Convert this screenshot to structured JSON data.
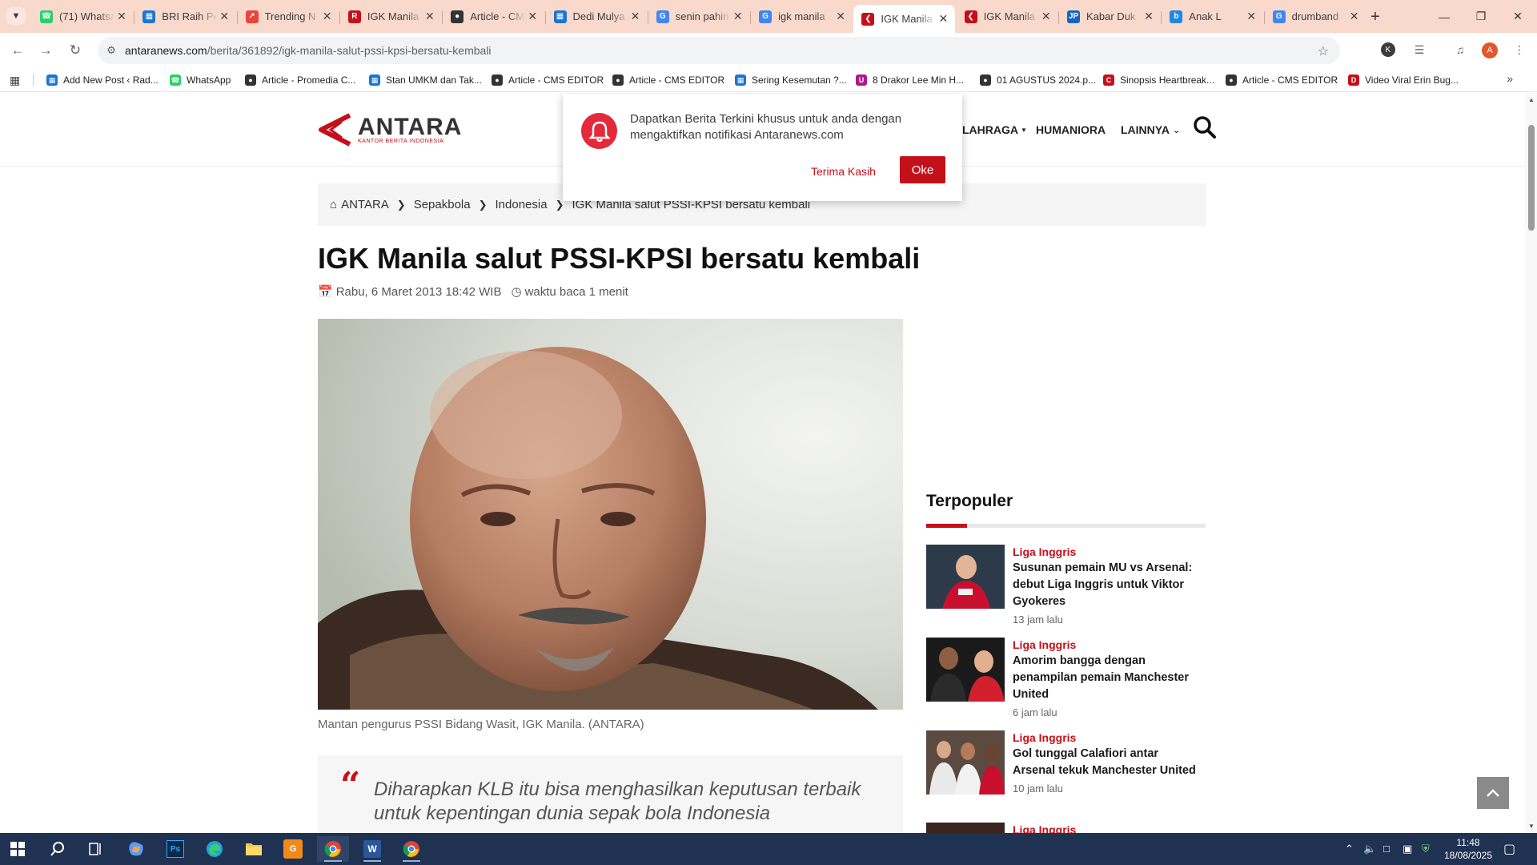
{
  "browser": {
    "tabs": [
      {
        "title": "(71) WhatsApp",
        "icon": "whatsapp-icon",
        "color": "#25d366"
      },
      {
        "title": "BRI Raih Pe",
        "icon": "blogger-doc-icon",
        "color": "#1976d2"
      },
      {
        "title": "Trending N",
        "icon": "trending-icon",
        "color": "#e8453c"
      },
      {
        "title": "IGK Manila",
        "icon": "r-logo-icon",
        "color": "#c4101a"
      },
      {
        "title": "Article - CM",
        "icon": "cms-icon",
        "color": "#333333"
      },
      {
        "title": "Dedi Mulya",
        "icon": "blogger-doc-icon",
        "color": "#1976d2"
      },
      {
        "title": "senin pahin",
        "icon": "google-icon",
        "color": "#4285f4"
      },
      {
        "title": "igk manila",
        "icon": "google-icon",
        "color": "#4285f4"
      },
      {
        "title": "IGK Manila",
        "icon": "antara-icon",
        "color": "#c4101a",
        "active": true
      },
      {
        "title": "IGK Manila",
        "icon": "antara-icon",
        "color": "#c4101a"
      },
      {
        "title": "Kabar Duk",
        "icon": "jp-icon",
        "color": "#1565c0"
      },
      {
        "title": "Anak L",
        "icon": "bing-icon",
        "color": "#1e88e5"
      },
      {
        "title": "drumband",
        "icon": "google-icon",
        "color": "#4285f4"
      }
    ],
    "url_host": "antaranews.com",
    "url_path": "/berita/361892/igk-manila-salut-pssi-kpsi-bersatu-kembali",
    "profile_initial": "A",
    "extension_initial": "K",
    "bookmarks": [
      {
        "label": "Add New Post ‹ Rad...",
        "icon": "blogger-doc-icon",
        "color": "#1976d2"
      },
      {
        "label": "WhatsApp",
        "icon": "whatsapp-icon",
        "color": "#25d366"
      },
      {
        "label": "Article - Promedia C...",
        "icon": "cms-icon",
        "color": "#333333"
      },
      {
        "label": "Stan UMKM dan Tak...",
        "icon": "blogger-doc-icon",
        "color": "#1976d2"
      },
      {
        "label": "Article - CMS EDITOR",
        "icon": "globe-icon",
        "color": "#333333"
      },
      {
        "label": "Article - CMS EDITOR",
        "icon": "cms-icon",
        "color": "#333333"
      },
      {
        "label": "Sering Kesemutan ?...",
        "icon": "blogger-doc-icon",
        "color": "#1976d2"
      },
      {
        "label": "8 Drakor Lee Min H...",
        "icon": "u-icon",
        "color": "#b0198a"
      },
      {
        "label": "01 AGUSTUS 2024.p...",
        "icon": "globe-icon",
        "color": "#333333"
      },
      {
        "label": "Sinopsis Heartbreak...",
        "icon": "cnn-icon",
        "color": "#c4101a"
      },
      {
        "label": "Article - CMS EDITOR",
        "icon": "cms-icon",
        "color": "#333333"
      },
      {
        "label": "Video Viral Erin Bug...",
        "icon": "d-icon",
        "color": "#c4101a"
      }
    ]
  },
  "site": {
    "logo_name": "ANTARA",
    "logo_sub": "KANTOR BERITA INDONESIA",
    "nav": [
      "LAHRAGA",
      "HUMANIORA",
      "LAINNYA"
    ],
    "accent": "#c4101a"
  },
  "notification": {
    "text": "Dapatkan Berita Terkini khusus untuk anda dengan mengaktifkan notifikasi Antaranews.com",
    "decline": "Terima Kasih",
    "accept": "Oke"
  },
  "breadcrumb": [
    "ANTARA",
    "Sepakbola",
    "Indonesia",
    "IGK Manila salut PSSI-KPSI bersatu kembali"
  ],
  "article": {
    "title": "IGK Manila salut PSSI-KPSI bersatu kembali",
    "date": "Rabu, 6 Maret 2013 18:42 WIB",
    "read_time": "waktu baca 1 menit",
    "caption": "Mantan pengurus PSSI Bidang Wasit, IGK Manila. (ANTARA)",
    "quote": "Diharapkan KLB itu bisa menghasilkan keputusan terbaik untuk kepentingan dunia sepak bola Indonesia"
  },
  "sidebar": {
    "title": "Terpopuler",
    "items": [
      {
        "category": "Liga Inggris",
        "headline": "Susunan pemain MU vs Arsenal: debut Liga Inggris untuk Viktor Gyokeres",
        "time": "13 jam lalu"
      },
      {
        "category": "Liga Inggris",
        "headline": "Amorim bangga dengan penampilan pemain Manchester United",
        "time": "6 jam lalu"
      },
      {
        "category": "Liga Inggris",
        "headline": "Gol tunggal Calafiori antar Arsenal tekuk Manchester United",
        "time": "10 jam lalu"
      },
      {
        "category": "Liga Inggris",
        "headline": "",
        "time": ""
      }
    ]
  },
  "taskbar": {
    "time": "11:48",
    "date": "18/08/2025"
  }
}
